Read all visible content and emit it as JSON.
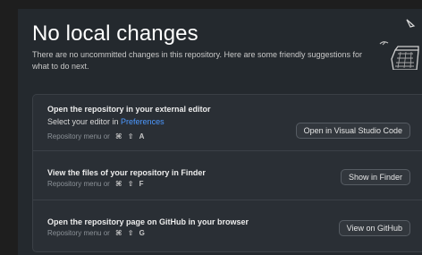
{
  "header": {
    "title": "No local changes",
    "subtitle": "There are no uncommitted changes in this repository. Here are some friendly suggestions for what to do next."
  },
  "cards": [
    {
      "title": "Open the repository in your external editor",
      "desc_prefix": "Select your editor in ",
      "desc_link": "Preferences",
      "hint": "Repository menu or",
      "keys": [
        "⌘",
        "⇧",
        "A"
      ],
      "button": "Open in Visual Studio Code"
    },
    {
      "title": "View the files of your repository in Finder",
      "hint": "Repository menu or",
      "keys": [
        "⌘",
        "⇧",
        "F"
      ],
      "button": "Show in Finder"
    },
    {
      "title": "Open the repository page on GitHub in your browser",
      "hint": "Repository menu or",
      "keys": [
        "⌘",
        "⇧",
        "G"
      ],
      "button": "View on GitHub"
    }
  ],
  "colors": {
    "background": "#24292e",
    "panel": "#2a2f35",
    "link": "#4c98ff",
    "button": "#32373d"
  },
  "icons": [
    "paper-plane-illustration",
    "box-illustration"
  ]
}
